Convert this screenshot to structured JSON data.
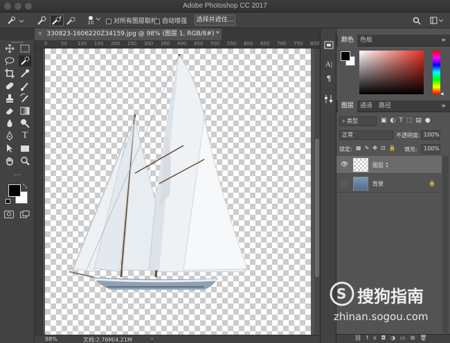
{
  "window": {
    "title": "Adobe Photoshop CC 2017"
  },
  "options_bar": {
    "brush_size": "10",
    "sample_all_layers_label": "对所有图层取样",
    "auto_enhance_label": "自动增强",
    "select_and_mask_label": "选择并遮住..."
  },
  "document_tab": {
    "label": "330823-1606220Z34159.jpg @ 98% (图层 1, RGB/8#) *"
  },
  "ruler": {
    "ticks": [
      "0",
      "50",
      "100",
      "150",
      "200",
      "250",
      "300",
      "350",
      "400",
      "450",
      "500",
      "550",
      "600",
      "650",
      "700",
      "750",
      "800"
    ]
  },
  "status_bar": {
    "zoom": "98%",
    "doc_info": "文档:2.76M/4.21M"
  },
  "color_panel": {
    "tabs": [
      "颜色",
      "色板"
    ],
    "foreground": "#000000",
    "background": "#ffffff",
    "hue": "#e53023"
  },
  "layers_panel": {
    "tabs": [
      "图层",
      "通道",
      "路径"
    ],
    "filter_label": "类型",
    "blend_mode": "正常",
    "opacity_label": "不透明度:",
    "opacity_value": "100%",
    "lock_label": "锁定:",
    "fill_label": "填充:",
    "fill_value": "100%",
    "layers": [
      {
        "name": "图层 1",
        "visible": true,
        "selected": true
      },
      {
        "name": "背景",
        "visible": false,
        "locked": true
      }
    ]
  },
  "watermark": {
    "brand": "搜狗指南",
    "url": "zhinan.sogou.com"
  }
}
